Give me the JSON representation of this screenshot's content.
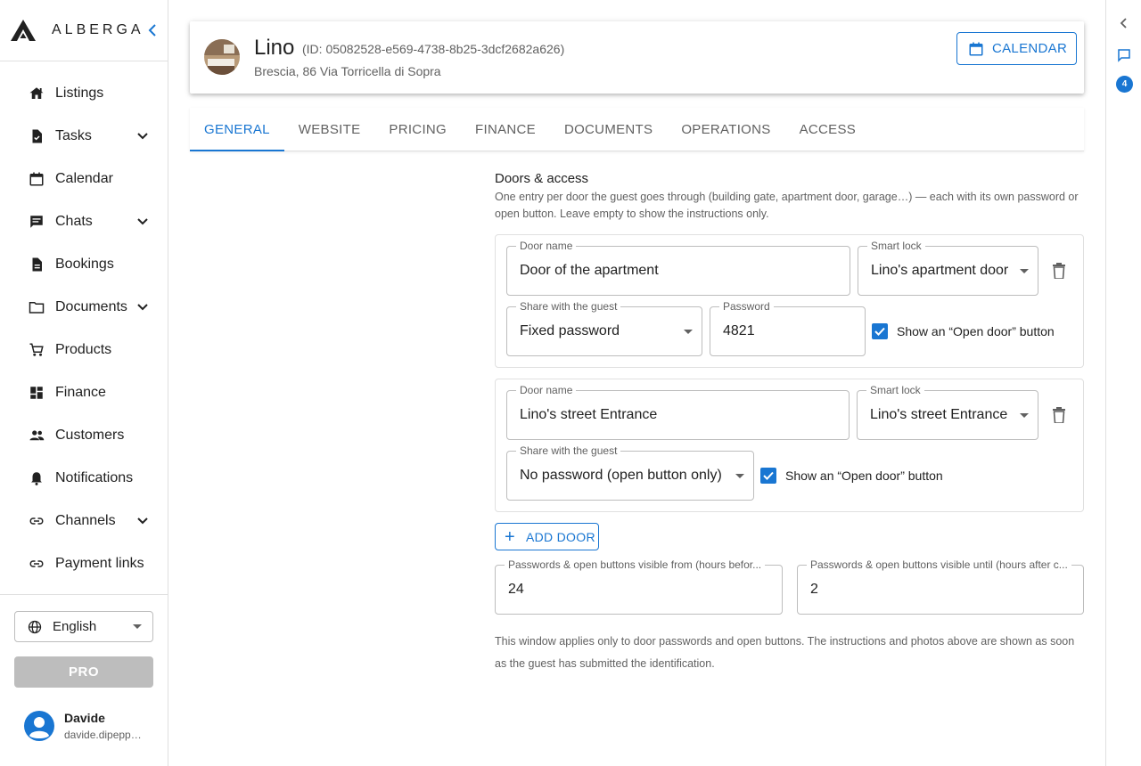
{
  "app": {
    "brand": "ALBERGA"
  },
  "sidebar": {
    "items": [
      {
        "label": "Listings",
        "icon": "home-icon",
        "has_children": false
      },
      {
        "label": "Tasks",
        "icon": "task-icon",
        "has_children": true
      },
      {
        "label": "Calendar",
        "icon": "calendar-icon",
        "has_children": false
      },
      {
        "label": "Chats",
        "icon": "chat-icon",
        "has_children": true
      },
      {
        "label": "Bookings",
        "icon": "document-icon",
        "has_children": false
      },
      {
        "label": "Documents",
        "icon": "folder-icon",
        "has_children": true
      },
      {
        "label": "Products",
        "icon": "cart-icon",
        "has_children": false
      },
      {
        "label": "Finance",
        "icon": "dashboard-icon",
        "has_children": false
      },
      {
        "label": "Customers",
        "icon": "people-icon",
        "has_children": false
      },
      {
        "label": "Notifications",
        "icon": "bell-icon",
        "has_children": false
      },
      {
        "label": "Channels",
        "icon": "link-icon",
        "has_children": true
      },
      {
        "label": "Payment links",
        "icon": "link-icon",
        "has_children": false
      }
    ],
    "language": "English",
    "pro_label": "PRO",
    "user": {
      "name": "Davide",
      "email": "davide.dipeppe@..."
    }
  },
  "rail": {
    "badge_count": "4"
  },
  "property": {
    "name": "Lino",
    "id_text": "(ID: 05082528-e569-4738-8b25-3dcf2682a626)",
    "address": "Brescia, 86 Via Torricella di Sopra",
    "calendar_label": "CALENDAR"
  },
  "tabs": [
    {
      "label": "GENERAL",
      "active": true
    },
    {
      "label": "WEBSITE",
      "active": false
    },
    {
      "label": "PRICING",
      "active": false
    },
    {
      "label": "FINANCE",
      "active": false
    },
    {
      "label": "DOCUMENTS",
      "active": false
    },
    {
      "label": "OPERATIONS",
      "active": false
    },
    {
      "label": "ACCESS",
      "active": false
    }
  ],
  "access": {
    "title": "Doors & access",
    "description": "One entry per door the guest goes through (building gate, apartment door, garage…) — each with its own password or open button. Leave empty to show the instructions only.",
    "doors": [
      {
        "door_name_label": "Door name",
        "door_name": "Door of the apartment",
        "smart_lock_label": "Smart lock",
        "smart_lock": "Lino's apartment door",
        "share_label": "Share with the guest",
        "share_value": "Fixed password",
        "password_label": "Password",
        "password": "4821",
        "open_button_label": "Show an “Open door” button",
        "open_button_checked": true
      },
      {
        "door_name_label": "Door name",
        "door_name": "Lino's street Entrance",
        "smart_lock_label": "Smart lock",
        "smart_lock": "Lino's street Entrance",
        "share_label": "Share with the guest",
        "share_value": "No password (open button only)",
        "open_button_label": "Show an “Open door” button",
        "open_button_checked": true
      }
    ],
    "add_door_label": "ADD DOOR",
    "visible_from_label": "Passwords & open buttons visible from (hours befor...",
    "visible_from": "24",
    "visible_until_label": "Passwords & open buttons visible until (hours after c...",
    "visible_until": "2",
    "footnote": "This window applies only to door passwords and open buttons. The instructions and photos above are shown as soon as the guest has submitted the identification."
  },
  "colors": {
    "accent": "#1976d2",
    "disabled": "#bdbdbd",
    "brand_dark": "#212121"
  }
}
